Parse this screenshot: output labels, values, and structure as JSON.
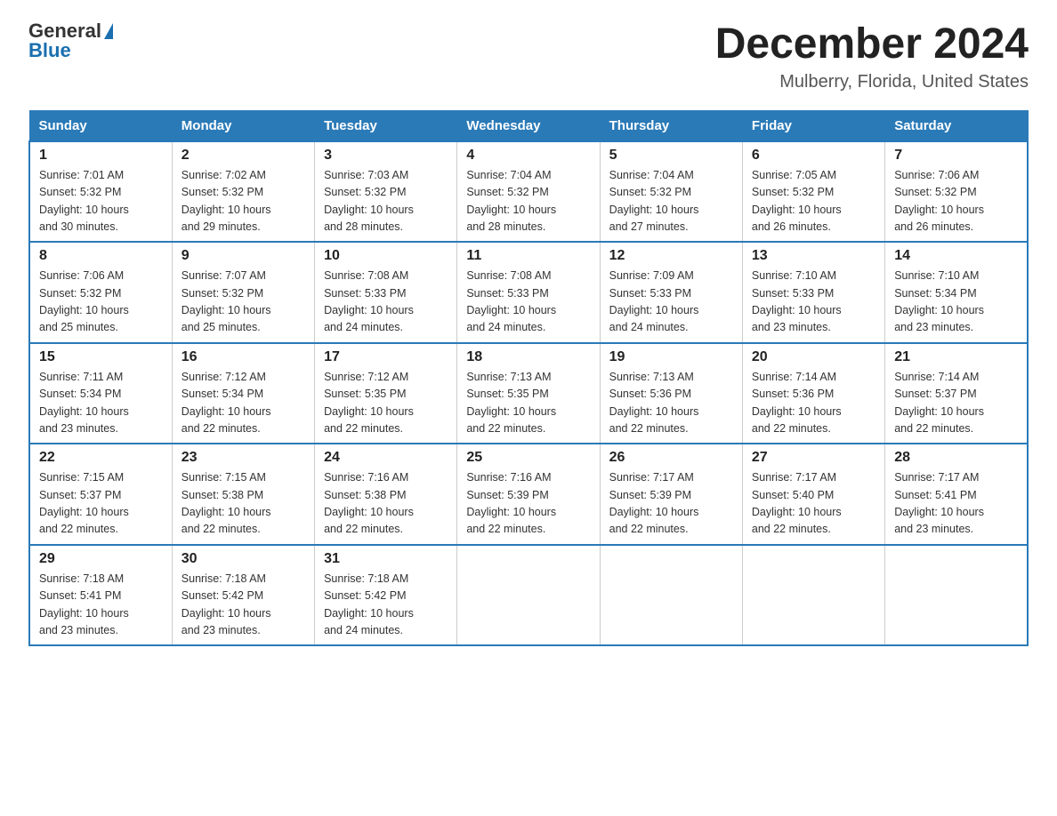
{
  "logo": {
    "text_general": "General",
    "triangle_symbol": "▶",
    "text_blue": "Blue"
  },
  "title": "December 2024",
  "subtitle": "Mulberry, Florida, United States",
  "weekdays": [
    "Sunday",
    "Monday",
    "Tuesday",
    "Wednesday",
    "Thursday",
    "Friday",
    "Saturday"
  ],
  "weeks": [
    [
      {
        "day": "1",
        "sunrise": "7:01 AM",
        "sunset": "5:32 PM",
        "daylight": "10 hours and 30 minutes."
      },
      {
        "day": "2",
        "sunrise": "7:02 AM",
        "sunset": "5:32 PM",
        "daylight": "10 hours and 29 minutes."
      },
      {
        "day": "3",
        "sunrise": "7:03 AM",
        "sunset": "5:32 PM",
        "daylight": "10 hours and 28 minutes."
      },
      {
        "day": "4",
        "sunrise": "7:04 AM",
        "sunset": "5:32 PM",
        "daylight": "10 hours and 28 minutes."
      },
      {
        "day": "5",
        "sunrise": "7:04 AM",
        "sunset": "5:32 PM",
        "daylight": "10 hours and 27 minutes."
      },
      {
        "day": "6",
        "sunrise": "7:05 AM",
        "sunset": "5:32 PM",
        "daylight": "10 hours and 26 minutes."
      },
      {
        "day": "7",
        "sunrise": "7:06 AM",
        "sunset": "5:32 PM",
        "daylight": "10 hours and 26 minutes."
      }
    ],
    [
      {
        "day": "8",
        "sunrise": "7:06 AM",
        "sunset": "5:32 PM",
        "daylight": "10 hours and 25 minutes."
      },
      {
        "day": "9",
        "sunrise": "7:07 AM",
        "sunset": "5:32 PM",
        "daylight": "10 hours and 25 minutes."
      },
      {
        "day": "10",
        "sunrise": "7:08 AM",
        "sunset": "5:33 PM",
        "daylight": "10 hours and 24 minutes."
      },
      {
        "day": "11",
        "sunrise": "7:08 AM",
        "sunset": "5:33 PM",
        "daylight": "10 hours and 24 minutes."
      },
      {
        "day": "12",
        "sunrise": "7:09 AM",
        "sunset": "5:33 PM",
        "daylight": "10 hours and 24 minutes."
      },
      {
        "day": "13",
        "sunrise": "7:10 AM",
        "sunset": "5:33 PM",
        "daylight": "10 hours and 23 minutes."
      },
      {
        "day": "14",
        "sunrise": "7:10 AM",
        "sunset": "5:34 PM",
        "daylight": "10 hours and 23 minutes."
      }
    ],
    [
      {
        "day": "15",
        "sunrise": "7:11 AM",
        "sunset": "5:34 PM",
        "daylight": "10 hours and 23 minutes."
      },
      {
        "day": "16",
        "sunrise": "7:12 AM",
        "sunset": "5:34 PM",
        "daylight": "10 hours and 22 minutes."
      },
      {
        "day": "17",
        "sunrise": "7:12 AM",
        "sunset": "5:35 PM",
        "daylight": "10 hours and 22 minutes."
      },
      {
        "day": "18",
        "sunrise": "7:13 AM",
        "sunset": "5:35 PM",
        "daylight": "10 hours and 22 minutes."
      },
      {
        "day": "19",
        "sunrise": "7:13 AM",
        "sunset": "5:36 PM",
        "daylight": "10 hours and 22 minutes."
      },
      {
        "day": "20",
        "sunrise": "7:14 AM",
        "sunset": "5:36 PM",
        "daylight": "10 hours and 22 minutes."
      },
      {
        "day": "21",
        "sunrise": "7:14 AM",
        "sunset": "5:37 PM",
        "daylight": "10 hours and 22 minutes."
      }
    ],
    [
      {
        "day": "22",
        "sunrise": "7:15 AM",
        "sunset": "5:37 PM",
        "daylight": "10 hours and 22 minutes."
      },
      {
        "day": "23",
        "sunrise": "7:15 AM",
        "sunset": "5:38 PM",
        "daylight": "10 hours and 22 minutes."
      },
      {
        "day": "24",
        "sunrise": "7:16 AM",
        "sunset": "5:38 PM",
        "daylight": "10 hours and 22 minutes."
      },
      {
        "day": "25",
        "sunrise": "7:16 AM",
        "sunset": "5:39 PM",
        "daylight": "10 hours and 22 minutes."
      },
      {
        "day": "26",
        "sunrise": "7:17 AM",
        "sunset": "5:39 PM",
        "daylight": "10 hours and 22 minutes."
      },
      {
        "day": "27",
        "sunrise": "7:17 AM",
        "sunset": "5:40 PM",
        "daylight": "10 hours and 22 minutes."
      },
      {
        "day": "28",
        "sunrise": "7:17 AM",
        "sunset": "5:41 PM",
        "daylight": "10 hours and 23 minutes."
      }
    ],
    [
      {
        "day": "29",
        "sunrise": "7:18 AM",
        "sunset": "5:41 PM",
        "daylight": "10 hours and 23 minutes."
      },
      {
        "day": "30",
        "sunrise": "7:18 AM",
        "sunset": "5:42 PM",
        "daylight": "10 hours and 23 minutes."
      },
      {
        "day": "31",
        "sunrise": "7:18 AM",
        "sunset": "5:42 PM",
        "daylight": "10 hours and 24 minutes."
      },
      null,
      null,
      null,
      null
    ]
  ],
  "labels": {
    "sunrise": "Sunrise: ",
    "sunset": "Sunset: ",
    "daylight": "Daylight: "
  }
}
